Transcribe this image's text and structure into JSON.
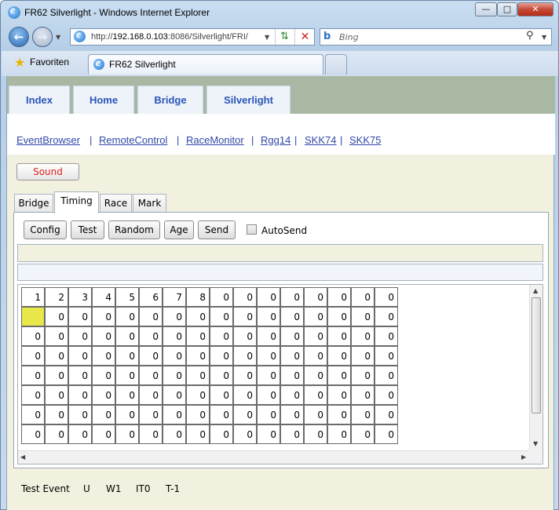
{
  "window": {
    "title": "FR62 Silverlight - Windows Internet Explorer",
    "minimize": "—",
    "maximize": "□",
    "close": "✕"
  },
  "address": {
    "url_prefix": "http://",
    "url_host": "192.168.0.103",
    "url_rest": ":8086/Silverlight/FRI/",
    "search_placeholder": "Bing"
  },
  "favorites": {
    "label": "Favoriten"
  },
  "tabs": [
    {
      "label": "FR62 Silverlight"
    }
  ],
  "topnav": [
    "Index",
    "Home",
    "Bridge",
    "Silverlight"
  ],
  "links": [
    "EventBrowser",
    "RemoteControl",
    "RaceMonitor",
    "Rgg14",
    "SKK74",
    "SKK75"
  ],
  "link_sep": "|",
  "sound_label": "Sound",
  "subtabs": [
    "Bridge",
    "Timing",
    "Race",
    "Mark"
  ],
  "active_subtab": "Timing",
  "toolbar": {
    "buttons": [
      "Config",
      "Test",
      "Random",
      "Age",
      "Send"
    ],
    "autosend_label": "AutoSend",
    "autosend_checked": false
  },
  "grid": {
    "header": [
      "1",
      "2",
      "3",
      "4",
      "5",
      "6",
      "7",
      "8",
      "0",
      "0",
      "0",
      "0",
      "0",
      "0",
      "0",
      "0"
    ],
    "rows": [
      [
        "",
        "0",
        "0",
        "0",
        "0",
        "0",
        "0",
        "0",
        "0",
        "0",
        "0",
        "0",
        "0",
        "0",
        "0",
        "0"
      ],
      [
        "0",
        "0",
        "0",
        "0",
        "0",
        "0",
        "0",
        "0",
        "0",
        "0",
        "0",
        "0",
        "0",
        "0",
        "0",
        "0"
      ],
      [
        "0",
        "0",
        "0",
        "0",
        "0",
        "0",
        "0",
        "0",
        "0",
        "0",
        "0",
        "0",
        "0",
        "0",
        "0",
        "0"
      ],
      [
        "0",
        "0",
        "0",
        "0",
        "0",
        "0",
        "0",
        "0",
        "0",
        "0",
        "0",
        "0",
        "0",
        "0",
        "0",
        "0"
      ],
      [
        "0",
        "0",
        "0",
        "0",
        "0",
        "0",
        "0",
        "0",
        "0",
        "0",
        "0",
        "0",
        "0",
        "0",
        "0",
        "0"
      ],
      [
        "0",
        "0",
        "0",
        "0",
        "0",
        "0",
        "0",
        "0",
        "0",
        "0",
        "0",
        "0",
        "0",
        "0",
        "0",
        "0"
      ],
      [
        "0",
        "0",
        "0",
        "0",
        "0",
        "0",
        "0",
        "0",
        "0",
        "0",
        "0",
        "0",
        "0",
        "0",
        "0",
        "0"
      ]
    ],
    "highlight_color": "#e9e84a"
  },
  "status": [
    "Test Event",
    "U",
    "W1",
    "IT0",
    "T-1"
  ],
  "colors": {
    "link": "#3048a8",
    "nav_text": "#2b55b8",
    "sound_text": "#e02020",
    "page_bg": "#f2f1df",
    "nav_bar": "#a9b8a3"
  }
}
